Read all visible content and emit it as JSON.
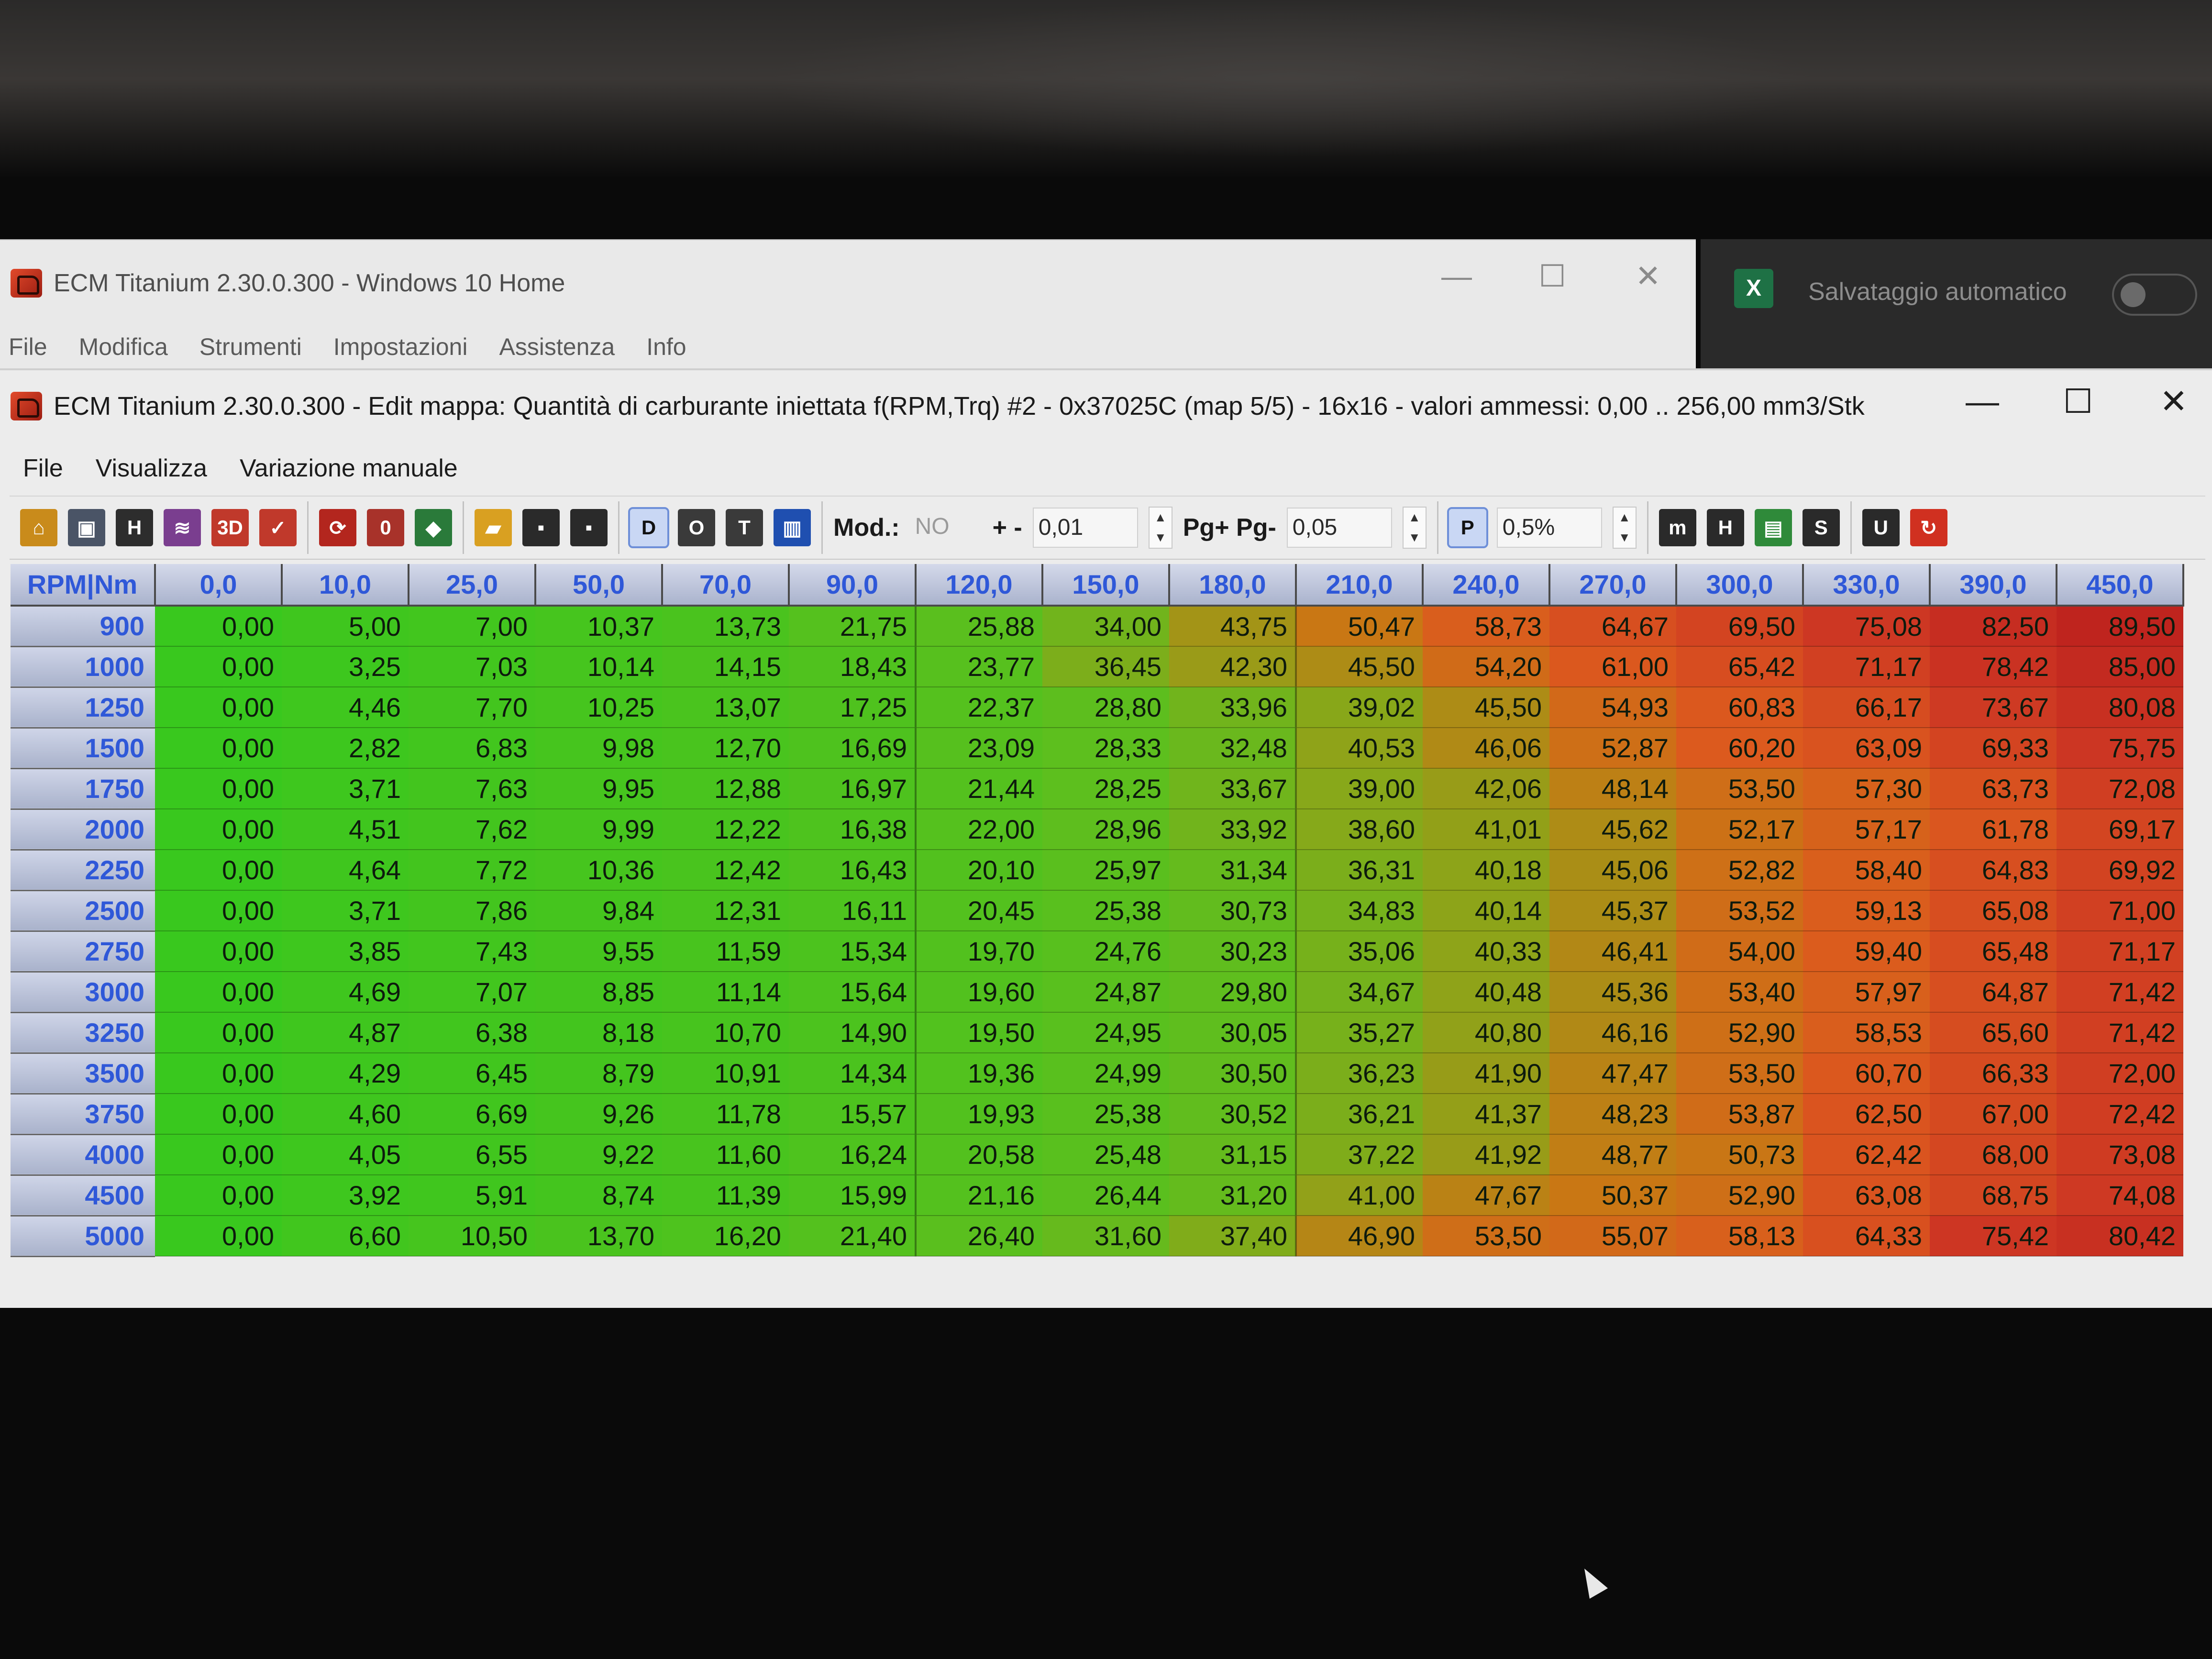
{
  "main_window": {
    "title": "ECM Titanium 2.30.0.300 - Windows 10 Home",
    "menu": [
      "File",
      "Modifica",
      "Strumenti",
      "Impostazioni",
      "Assistenza",
      "Info"
    ],
    "sys_buttons": {
      "minimize": "—",
      "maximize": "☐",
      "close": "✕"
    }
  },
  "excel": {
    "logo": "X",
    "autosave_label": "Salvataggio automatico"
  },
  "edit_window": {
    "title": "ECM Titanium 2.30.0.300 - Edit mappa: Quantità di carburante iniettata f(RPM,Trq) #2 - 0x37025C (map 5/5) - 16x16 - valori ammessi: 0,00 .. 256,00 mm3/Stk",
    "menu": [
      "File",
      "Visualizza",
      "Variazione manuale"
    ],
    "sys_buttons": {
      "minimize": "—",
      "maximize": "☐",
      "close": "✕"
    }
  },
  "toolbar": {
    "mod_label": "Mod.:",
    "mod_value": "NO",
    "plusminus_label": "+ -",
    "step_value": "0,01",
    "pg_label": "Pg+ Pg-",
    "pg_value": "0,05",
    "percent_value": "0,5%",
    "icons": [
      "home-icon",
      "windows-icon",
      "h-icon",
      "graph-icon",
      "3d-icon",
      "check-icon",
      "refresh-icon",
      "zero-icon",
      "shapes-icon",
      "open-icon",
      "save-icon",
      "save-as-icon",
      "view-d-icon",
      "view-o-icon",
      "view-t-icon",
      "view-split-icon",
      "p-icon",
      "m-icon",
      "h2-icon",
      "color-icon",
      "s-icon",
      "u-icon",
      "reload-icon"
    ]
  },
  "map": {
    "corner": "RPM|Nm",
    "columns": [
      "0,0",
      "10,0",
      "25,0",
      "50,0",
      "70,0",
      "90,0",
      "120,0",
      "150,0",
      "180,0",
      "210,0",
      "240,0",
      "270,0",
      "300,0",
      "330,0",
      "390,0",
      "450,0"
    ],
    "rows": [
      {
        "rpm": "900",
        "values": [
          "0,00",
          "5,00",
          "7,00",
          "10,37",
          "13,73",
          "21,75",
          "25,88",
          "34,00",
          "43,75",
          "50,47",
          "58,73",
          "64,67",
          "69,50",
          "75,08",
          "82,50",
          "89,50"
        ]
      },
      {
        "rpm": "1000",
        "values": [
          "0,00",
          "3,25",
          "7,03",
          "10,14",
          "14,15",
          "18,43",
          "23,77",
          "36,45",
          "42,30",
          "45,50",
          "54,20",
          "61,00",
          "65,42",
          "71,17",
          "78,42",
          "85,00"
        ]
      },
      {
        "rpm": "1250",
        "values": [
          "0,00",
          "4,46",
          "7,70",
          "10,25",
          "13,07",
          "17,25",
          "22,37",
          "28,80",
          "33,96",
          "39,02",
          "45,50",
          "54,93",
          "60,83",
          "66,17",
          "73,67",
          "80,08"
        ]
      },
      {
        "rpm": "1500",
        "values": [
          "0,00",
          "2,82",
          "6,83",
          "9,98",
          "12,70",
          "16,69",
          "23,09",
          "28,33",
          "32,48",
          "40,53",
          "46,06",
          "52,87",
          "60,20",
          "63,09",
          "69,33",
          "75,75"
        ]
      },
      {
        "rpm": "1750",
        "values": [
          "0,00",
          "3,71",
          "7,63",
          "9,95",
          "12,88",
          "16,97",
          "21,44",
          "28,25",
          "33,67",
          "39,00",
          "42,06",
          "48,14",
          "53,50",
          "57,30",
          "63,73",
          "72,08"
        ]
      },
      {
        "rpm": "2000",
        "values": [
          "0,00",
          "4,51",
          "7,62",
          "9,99",
          "12,22",
          "16,38",
          "22,00",
          "28,96",
          "33,92",
          "38,60",
          "41,01",
          "45,62",
          "52,17",
          "57,17",
          "61,78",
          "69,17"
        ]
      },
      {
        "rpm": "2250",
        "values": [
          "0,00",
          "4,64",
          "7,72",
          "10,36",
          "12,42",
          "16,43",
          "20,10",
          "25,97",
          "31,34",
          "36,31",
          "40,18",
          "45,06",
          "52,82",
          "58,40",
          "64,83",
          "69,92"
        ]
      },
      {
        "rpm": "2500",
        "values": [
          "0,00",
          "3,71",
          "7,86",
          "9,84",
          "12,31",
          "16,11",
          "20,45",
          "25,38",
          "30,73",
          "34,83",
          "40,14",
          "45,37",
          "53,52",
          "59,13",
          "65,08",
          "71,00"
        ]
      },
      {
        "rpm": "2750",
        "values": [
          "0,00",
          "3,85",
          "7,43",
          "9,55",
          "11,59",
          "15,34",
          "19,70",
          "24,76",
          "30,23",
          "35,06",
          "40,33",
          "46,41",
          "54,00",
          "59,40",
          "65,48",
          "71,17"
        ]
      },
      {
        "rpm": "3000",
        "values": [
          "0,00",
          "4,69",
          "7,07",
          "8,85",
          "11,14",
          "15,64",
          "19,60",
          "24,87",
          "29,80",
          "34,67",
          "40,48",
          "45,36",
          "53,40",
          "57,97",
          "64,87",
          "71,42"
        ]
      },
      {
        "rpm": "3250",
        "values": [
          "0,00",
          "4,87",
          "6,38",
          "8,18",
          "10,70",
          "14,90",
          "19,50",
          "24,95",
          "30,05",
          "35,27",
          "40,80",
          "46,16",
          "52,90",
          "58,53",
          "65,60",
          "71,42"
        ]
      },
      {
        "rpm": "3500",
        "values": [
          "0,00",
          "4,29",
          "6,45",
          "8,79",
          "10,91",
          "14,34",
          "19,36",
          "24,99",
          "30,50",
          "36,23",
          "41,90",
          "47,47",
          "53,50",
          "60,70",
          "66,33",
          "72,00"
        ]
      },
      {
        "rpm": "3750",
        "values": [
          "0,00",
          "4,60",
          "6,69",
          "9,26",
          "11,78",
          "15,57",
          "19,93",
          "25,38",
          "30,52",
          "36,21",
          "41,37",
          "48,23",
          "53,87",
          "62,50",
          "67,00",
          "72,42"
        ]
      },
      {
        "rpm": "4000",
        "values": [
          "0,00",
          "4,05",
          "6,55",
          "9,22",
          "11,60",
          "16,24",
          "20,58",
          "25,48",
          "31,15",
          "37,22",
          "41,92",
          "48,77",
          "50,73",
          "62,42",
          "68,00",
          "73,08"
        ]
      },
      {
        "rpm": "4500",
        "values": [
          "0,00",
          "3,92",
          "5,91",
          "8,74",
          "11,39",
          "15,99",
          "21,16",
          "26,44",
          "31,20",
          "41,00",
          "47,67",
          "50,37",
          "52,90",
          "63,08",
          "68,75",
          "74,08"
        ]
      },
      {
        "rpm": "5000",
        "values": [
          "0,00",
          "6,60",
          "10,50",
          "13,70",
          "16,20",
          "21,40",
          "26,40",
          "31,60",
          "37,40",
          "46,90",
          "53,50",
          "55,07",
          "58,13",
          "64,33",
          "75,42",
          "80,42"
        ]
      }
    ]
  },
  "colors": {
    "low": "#39c81e",
    "mid": "#8ea51a",
    "high": "#d23a26",
    "header_text": "#2f58d8"
  }
}
